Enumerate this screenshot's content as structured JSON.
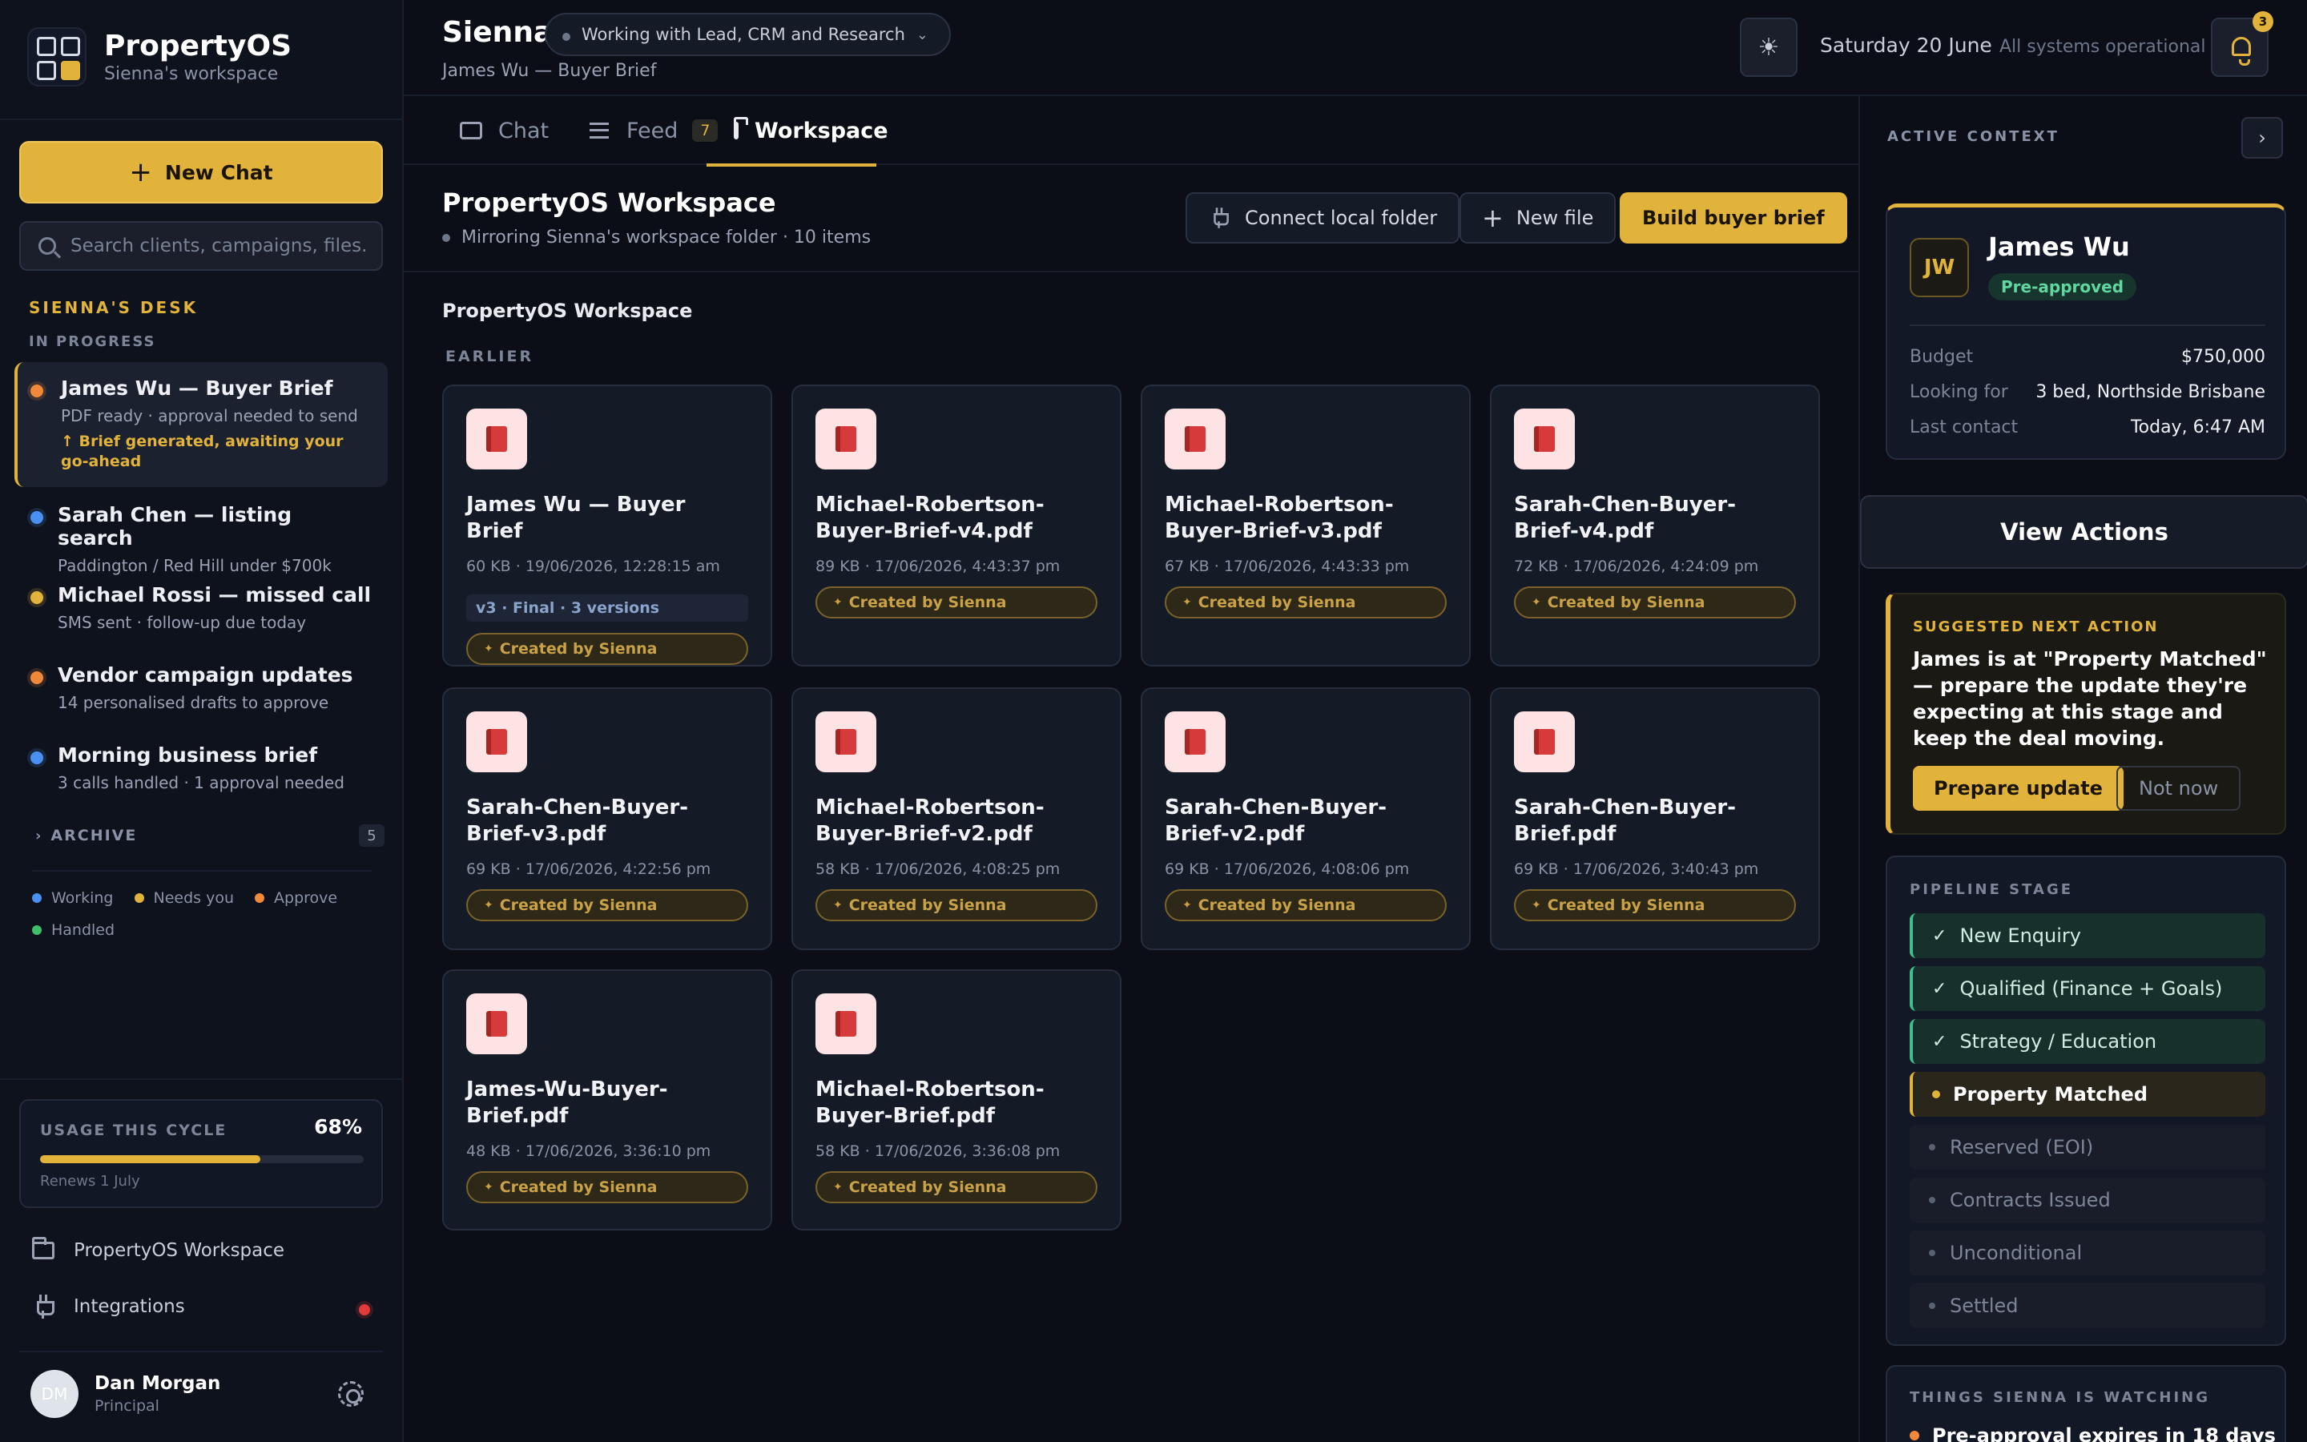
{
  "brand": {
    "name": "PropertyOS",
    "workspace": "Sienna's workspace"
  },
  "sidebar": {
    "new_chat": "New Chat",
    "search_placeholder": "Search clients, campaigns, files...",
    "desk_heading": "SIENNA'S DESK",
    "in_progress_heading": "IN PROGRESS",
    "conversations": [
      {
        "title": "James Wu — Buyer Brief",
        "sub": "PDF ready · approval needed to send",
        "note": "↑ Brief generated, awaiting your go-ahead",
        "dot": "orange",
        "active": true
      },
      {
        "title": "Sarah Chen — listing search",
        "sub": "Paddington / Red Hill under $700k",
        "dot": "blue"
      },
      {
        "title": "Michael Rossi — missed call",
        "sub": "SMS sent · follow-up due today",
        "dot": "yellow"
      },
      {
        "title": "Vendor campaign updates",
        "sub": "14 personalised drafts to approve",
        "dot": "orange"
      },
      {
        "title": "Morning business brief",
        "sub": "3 calls handled · 1 approval needed",
        "dot": "blue"
      }
    ],
    "archive": {
      "label": "ARCHIVE",
      "count": "5"
    },
    "legend": [
      {
        "label": "Working",
        "color": "#4a90f0"
      },
      {
        "label": "Needs you",
        "color": "#e2b33b"
      },
      {
        "label": "Approve",
        "color": "#f08a3a"
      },
      {
        "label": "Handled",
        "color": "#3fbf6a"
      }
    ],
    "usage": {
      "label": "USAGE THIS CYCLE",
      "percent_label": "68%",
      "percent": 68,
      "renews": "Renews 1 July"
    },
    "links": {
      "workspace": "PropertyOS Workspace",
      "integrations": "Integrations"
    },
    "user": {
      "initials": "DM",
      "name": "Dan Morgan",
      "role": "Principal"
    }
  },
  "topbar": {
    "agent": "Sienna",
    "context_pill": "Working with Lead, CRM and Research",
    "context_chevron": "⌄",
    "breadcrumb": "James Wu — Buyer Brief",
    "theme_icon": "☀",
    "date": "Saturday 20 June",
    "status": "All systems operational",
    "notifications": "3"
  },
  "tabs": {
    "chat": "Chat",
    "feed": "Feed",
    "feed_count": "7",
    "workspace": "Workspace"
  },
  "workspace": {
    "title": "PropertyOS Workspace",
    "subtitle": "Mirroring Sienna's workspace folder · 10 items",
    "connect": "Connect local folder",
    "new_file": "New file",
    "build": "Build buyer brief",
    "section": "PropertyOS Workspace",
    "group": "EARLIER",
    "files": [
      {
        "name": "James Wu — Buyer Brief",
        "meta": "60 KB · 19/06/2026, 12:28:15 am",
        "version": "v3 · Final · 3 versions",
        "badge": "Created by Sienna"
      },
      {
        "name": "Michael-Robertson-Buyer-Brief-v4.pdf",
        "meta": "89 KB · 17/06/2026, 4:43:37 pm",
        "badge": "Created by Sienna"
      },
      {
        "name": "Michael-Robertson-Buyer-Brief-v3.pdf",
        "meta": "67 KB · 17/06/2026, 4:43:33 pm",
        "badge": "Created by Sienna"
      },
      {
        "name": "Sarah-Chen-Buyer-Brief-v4.pdf",
        "meta": "72 KB · 17/06/2026, 4:24:09 pm",
        "badge": "Created by Sienna"
      },
      {
        "name": "Sarah-Chen-Buyer-Brief-v3.pdf",
        "meta": "69 KB · 17/06/2026, 4:22:56 pm",
        "badge": "Created by Sienna"
      },
      {
        "name": "Michael-Robertson-Buyer-Brief-v2.pdf",
        "meta": "58 KB · 17/06/2026, 4:08:25 pm",
        "badge": "Created by Sienna"
      },
      {
        "name": "Sarah-Chen-Buyer-Brief-v2.pdf",
        "meta": "69 KB · 17/06/2026, 4:08:06 pm",
        "badge": "Created by Sienna"
      },
      {
        "name": "Sarah-Chen-Buyer-Brief.pdf",
        "meta": "69 KB · 17/06/2026, 3:40:43 pm",
        "badge": "Created by Sienna"
      },
      {
        "name": "James-Wu-Buyer-Brief.pdf",
        "meta": "48 KB · 17/06/2026, 3:36:10 pm",
        "badge": "Created by Sienna"
      },
      {
        "name": "Michael-Robertson-Buyer-Brief.pdf",
        "meta": "58 KB · 17/06/2026, 3:36:08 pm",
        "badge": "Created by Sienna"
      }
    ]
  },
  "context": {
    "heading": "ACTIVE CONTEXT",
    "collapse_icon": "›",
    "client": {
      "initials": "JW",
      "name": "James Wu",
      "status": "Pre-approved",
      "fields": [
        {
          "k": "Budget",
          "v": "$750,000"
        },
        {
          "k": "Looking for",
          "v": "3 bed, Northside Brisbane"
        },
        {
          "k": "Last contact",
          "v": "Today, 6:47 AM"
        }
      ]
    },
    "view_actions": "View Actions",
    "suggest": {
      "heading": "SUGGESTED NEXT ACTION",
      "text": "James is at \"Property Matched\" — prepare the update they're expecting at this stage and keep the deal moving.",
      "primary": "Prepare update",
      "secondary": "Not now"
    },
    "pipeline": {
      "heading": "PIPELINE STAGE",
      "stages": [
        {
          "label": "New Enquiry",
          "state": "done"
        },
        {
          "label": "Qualified (Finance + Goals)",
          "state": "done"
        },
        {
          "label": "Strategy / Education",
          "state": "done"
        },
        {
          "label": "Property Matched",
          "state": "current"
        },
        {
          "label": "Reserved (EOI)",
          "state": "todo"
        },
        {
          "label": "Contracts Issued",
          "state": "todo"
        },
        {
          "label": "Unconditional",
          "state": "todo"
        },
        {
          "label": "Settled",
          "state": "todo"
        }
      ]
    },
    "watching": {
      "heading": "THINGS SIENNA IS WATCHING",
      "item": "Pre-approval expires in 18 days"
    }
  }
}
